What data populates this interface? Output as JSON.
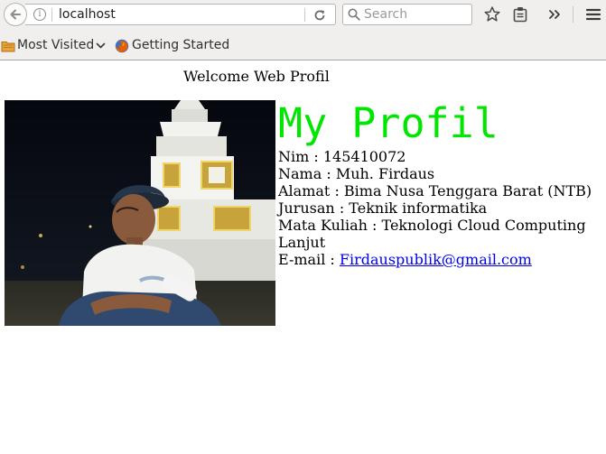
{
  "browser": {
    "url": "localhost",
    "search_placeholder": "Search",
    "bookmarks": {
      "most_visited": "Most Visited",
      "getting_started": "Getting Started"
    }
  },
  "page": {
    "welcome": "Welcome Web Profil",
    "title": "My Profil",
    "title_color": "#00e600",
    "fields": [
      "Nim : 145410072",
      "Nama : Muh. Firdaus",
      "Alamat : Bima Nusa Tenggara Barat (NTB)",
      "Jurusan : Teknik informatika",
      "Mata Kuliah : Teknologi Cloud Computing Lanjut"
    ],
    "email_label": "E-mail : ",
    "email": "Firdauspublik@gmail.com",
    "link_color": "#0000ee"
  }
}
